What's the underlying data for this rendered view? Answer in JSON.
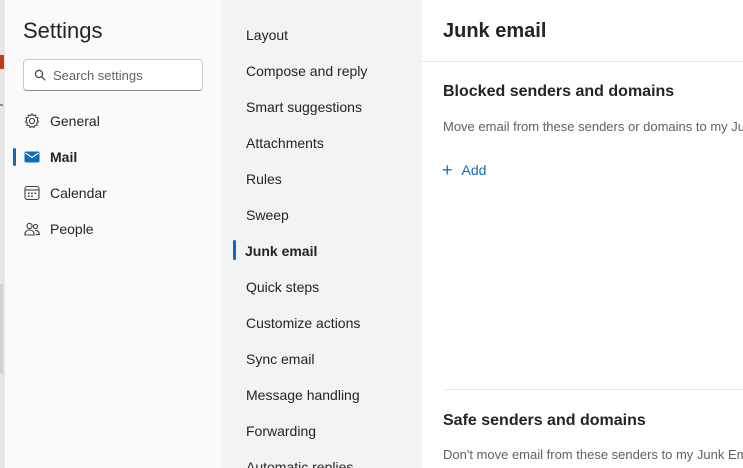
{
  "settings_nav": {
    "title": "Settings",
    "search_placeholder": "Search settings",
    "items": [
      {
        "label": "General",
        "icon": "gear-icon"
      },
      {
        "label": "Mail",
        "icon": "mail-icon",
        "selected": true
      },
      {
        "label": "Calendar",
        "icon": "calendar-icon"
      },
      {
        "label": "People",
        "icon": "people-icon"
      }
    ]
  },
  "mail_nav": {
    "items": [
      {
        "label": "Layout"
      },
      {
        "label": "Compose and reply"
      },
      {
        "label": "Smart suggestions"
      },
      {
        "label": "Attachments"
      },
      {
        "label": "Rules"
      },
      {
        "label": "Sweep"
      },
      {
        "label": "Junk email",
        "selected": true
      },
      {
        "label": "Quick steps"
      },
      {
        "label": "Customize actions"
      },
      {
        "label": "Sync email"
      },
      {
        "label": "Message handling"
      },
      {
        "label": "Forwarding"
      },
      {
        "label": "Automatic replies"
      }
    ]
  },
  "main": {
    "title": "Junk email",
    "blocked": {
      "title": "Blocked senders and domains",
      "description": "Move email from these senders or domains to my Junk Email folder.",
      "add_label": "Add"
    },
    "safe": {
      "title": "Safe senders and domains",
      "description": "Don't move email from these senders to my Junk Email folder."
    }
  },
  "colors": {
    "accent": "#0f6cbd",
    "nav_bg": "#fafafa",
    "subnav_bg": "#f3f3f3"
  }
}
